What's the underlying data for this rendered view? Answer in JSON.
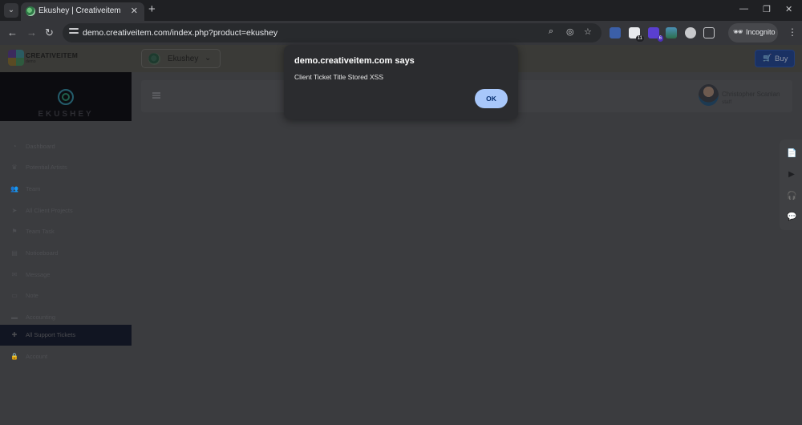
{
  "browser": {
    "tab": {
      "title": "Ekushey | Creativeitem",
      "close": "✕"
    },
    "new_tab": "+",
    "window_controls": {
      "minimize": "—",
      "restore": "❐",
      "close": "✕"
    },
    "nav": {
      "back": "←",
      "forward": "→",
      "reload": "↻"
    },
    "url": "demo.creativeitem.com/index.php?product=ekushey",
    "omnibox_icons": [
      "zoom-icon",
      "eye-off-icon",
      "star-icon"
    ],
    "extensions": [
      {
        "name": "extension-shield-icon",
        "color": "#3b5fa8",
        "badge": ""
      },
      {
        "name": "extension-calendar-icon",
        "color": "#e8eaed",
        "badge": "11"
      },
      {
        "name": "extension-purple-icon",
        "color": "#5a3fd0",
        "badge": "6"
      },
      {
        "name": "extension-mountain-icon",
        "color": "#4a8fb5",
        "badge": ""
      },
      {
        "name": "extension-globe-icon",
        "color": "#c8c9cc",
        "badge": ""
      },
      {
        "name": "extensions-puzzle-icon",
        "color": "#c8c9cc",
        "badge": ""
      }
    ],
    "incognito_label": "Incognito",
    "menu": "⋮"
  },
  "app": {
    "brand": {
      "name": "CREATIVEITEM",
      "sub": "demo"
    },
    "product": {
      "name": "Ekushey",
      "chevron": "⌄"
    },
    "buy_label": "Buy",
    "sidebar": {
      "logo_text": "EKUSHEY",
      "items": [
        {
          "label": "Dashboard",
          "icon": "◔"
        },
        {
          "label": "Potential Artists",
          "icon": "♛"
        },
        {
          "label": "Team",
          "icon": "👥"
        },
        {
          "label": "All Client Projects",
          "icon": "➤"
        },
        {
          "label": "Team Task",
          "icon": "⚑"
        },
        {
          "label": "Noticeboard",
          "icon": "▤"
        },
        {
          "label": "Message",
          "icon": "✉"
        },
        {
          "label": "Note",
          "icon": "▭"
        },
        {
          "label": "Accounting",
          "icon": "▬"
        },
        {
          "label": "All Support Tickets",
          "icon": "✚",
          "active": true
        },
        {
          "label": "Account",
          "icon": "🔒"
        }
      ]
    },
    "user": {
      "name": "Christopher Scanlan",
      "role": "staff"
    },
    "float_panel": [
      "📄",
      "▶",
      "🎧",
      "💬"
    ]
  },
  "dialog": {
    "title": "demo.creativeitem.com says",
    "message": "Client Ticket Title Stored XSS",
    "ok_label": "OK"
  }
}
